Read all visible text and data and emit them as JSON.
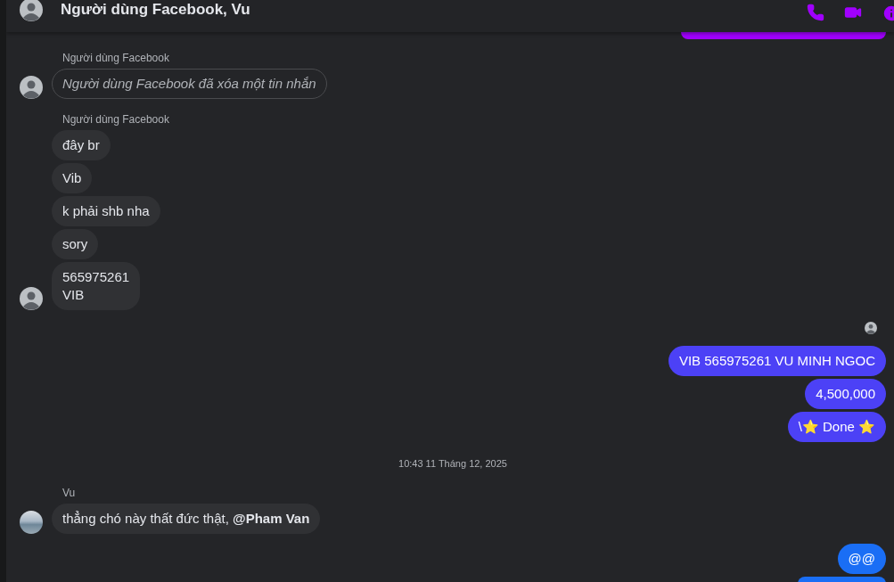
{
  "header": {
    "title": "Người dùng Facebook, Vu"
  },
  "items": [
    {
      "kind": "sent",
      "messages": [
        {
          "kind": "partial",
          "color": "#a100ff"
        }
      ]
    },
    {
      "kind": "group",
      "sender": "Người dùng Facebook",
      "avatar": {
        "kind": "silhouette"
      },
      "messages": [
        {
          "text": "Người dùng Facebook đã xóa một tin nhắn",
          "deleted": true
        }
      ]
    },
    {
      "kind": "group",
      "sender": "Người dùng Facebook",
      "avatar": {
        "kind": "silhouette"
      },
      "messages": [
        {
          "text": "đây br",
          "deleted": false
        },
        {
          "text": "Vib",
          "deleted": false
        },
        {
          "text": "k phải shb nha",
          "deleted": false
        },
        {
          "text": "sory",
          "deleted": false
        },
        {
          "text": "565975261\nVIB",
          "deleted": false
        }
      ]
    },
    {
      "kind": "seen"
    },
    {
      "kind": "sent",
      "messages": [
        {
          "kind": "text",
          "text": "VIB 565975261 VU MINH NGOC",
          "color": "#4c41f6"
        },
        {
          "kind": "text",
          "text": "4,500,000",
          "color": "#4c41f6"
        },
        {
          "kind": "text",
          "text": "\\⭐ Done ⭐",
          "color": "#4c41f6"
        }
      ]
    },
    {
      "kind": "timestamp",
      "text": "10:43 11 Tháng 12, 2025"
    },
    {
      "kind": "group",
      "sender": "Vu",
      "avatar": {
        "kind": "photo"
      },
      "messages": [
        {
          "text": "thẳng chó này thất đức thật, **@Pham Van**",
          "deleted": false
        }
      ]
    },
    {
      "kind": "sent",
      "messages": [
        {
          "kind": "text",
          "text": "@@",
          "color": "#1a6ef5"
        },
        {
          "kind": "partial_bottom",
          "color": "#1a6ef5"
        }
      ]
    }
  ]
}
